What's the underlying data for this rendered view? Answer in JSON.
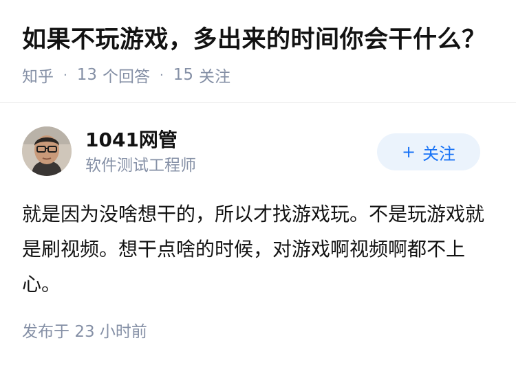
{
  "question": {
    "title": "如果不玩游戏，多出来的时间你会干什么？",
    "source": "知乎",
    "answer_count": "13",
    "answer_label": "个回答",
    "follower_count": "15",
    "follower_label": "关注"
  },
  "answer": {
    "author_name": "1041网管",
    "author_headline": "软件测试工程师",
    "follow_button_label": "关注",
    "follow_icon": "plus-icon",
    "content": "就是因为没啥想干的，所以才找游戏玩。不是玩游戏就是刷视频。想干点啥的时候，对游戏啊视频啊都不上心。",
    "published_label": "发布于",
    "published_time": "23 小时前"
  },
  "colors": {
    "title_text": "#121212",
    "meta_text": "#8590a6",
    "accent_blue": "#1772f6",
    "follow_button_bg": "#ebf3fc",
    "divider": "#ebebeb"
  }
}
